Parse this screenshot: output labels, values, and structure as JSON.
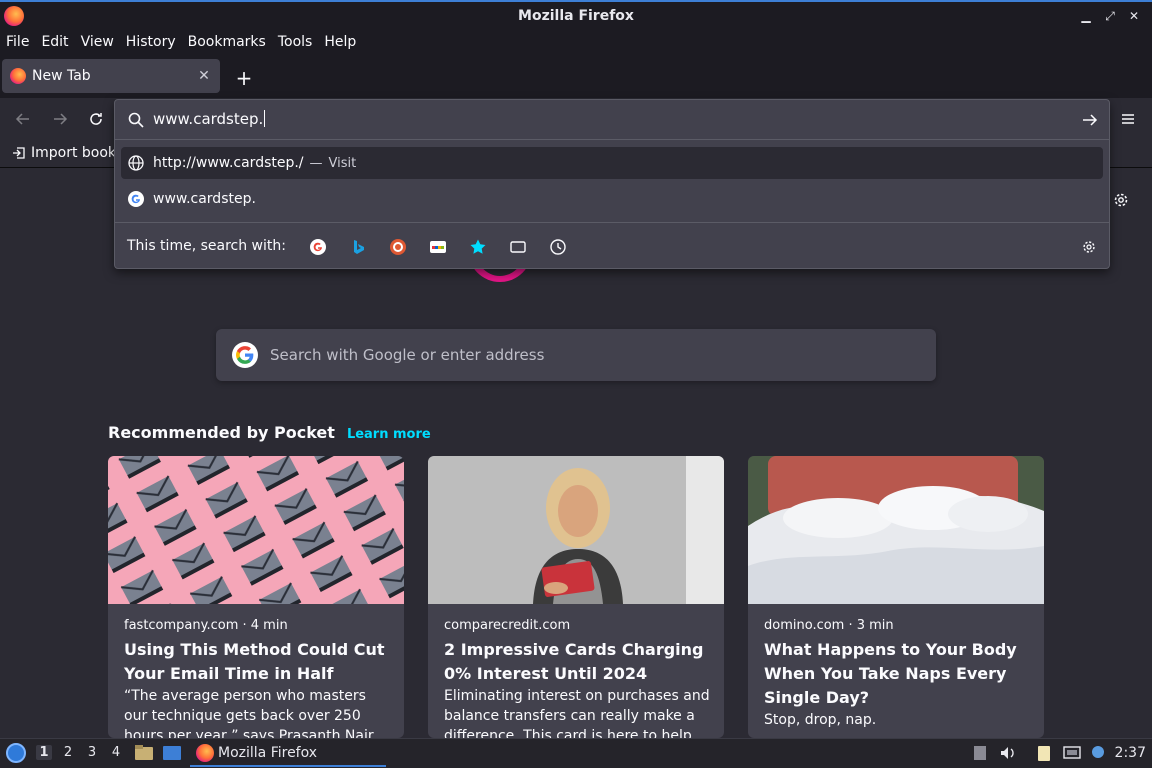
{
  "window": {
    "title": "Mozilla Firefox"
  },
  "menu": [
    "File",
    "Edit",
    "View",
    "History",
    "Bookmarks",
    "Tools",
    "Help"
  ],
  "tab": {
    "label": "New Tab"
  },
  "bookmarks": {
    "import_label": "Import book"
  },
  "urlbar": {
    "value": "www.cardstep.",
    "suggestions": [
      {
        "text": "http://www.cardstep./",
        "dash": "—",
        "action": "Visit",
        "icon": "globe-icon"
      },
      {
        "text": "www.cardstep.",
        "icon": "google-icon"
      }
    ],
    "search_with_label": "This time, search with:",
    "engines": [
      "google-icon",
      "bing-icon",
      "duckduckgo-icon",
      "ebay-icon",
      "bookmarks-star-icon",
      "tabs-icon",
      "history-clock-icon"
    ]
  },
  "newtab": {
    "search_placeholder": "Search with Google or enter address",
    "pocket_title": "Recommended by Pocket",
    "learn_more": "Learn more",
    "cards": [
      {
        "meta": "fastcompany.com · 4 min",
        "headline": "Using This Method Could Cut Your Email Time in Half",
        "excerpt": "“The average person who masters our technique gets back over 250 hours per year,” says Prasanth Nair, creator of the"
      },
      {
        "meta": "comparecredit.com",
        "headline": "2 Impressive Cards Charging 0% Interest Until 2024",
        "excerpt": "Eliminating interest on purchases and balance transfers can really make a difference. This card is here to help"
      },
      {
        "meta": "domino.com · 3 min",
        "headline": "What Happens to Your Body When You Take Naps Every Single Day?",
        "excerpt": "Stop, drop, nap."
      }
    ]
  },
  "taskbar": {
    "workspaces": [
      "1",
      "2",
      "3",
      "4"
    ],
    "task_label": "Mozilla Firefox",
    "clock": "2:37"
  },
  "colors": {
    "accent": "#00ddff",
    "panel": "#42414d",
    "background": "#2b2a33",
    "chrome": "#1c1b22"
  }
}
